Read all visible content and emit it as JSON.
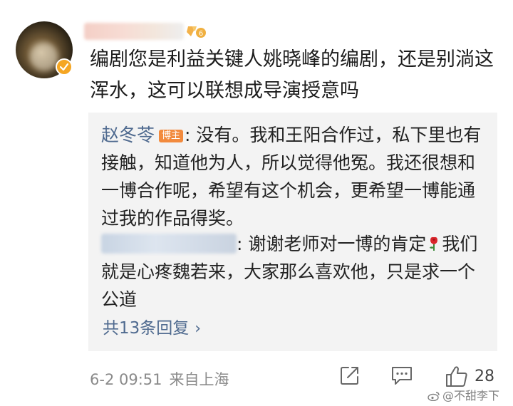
{
  "comment": {
    "text": "编剧您是利益关键人姚晓峰的编剧，还是别淌这浑水，这可以联想成导演授意吗"
  },
  "replies": [
    {
      "name": "赵冬苓",
      "tag": "博主",
      "text": ": 没有。我和王阳合作过，私下里也有接触，知道他为人，所以觉得他冤。我还很想和一博合作呢，希望有这个机会，更希望一博能通过我的作品得奖。"
    },
    {
      "text_before": ": 谢谢老师对一博的肯定",
      "text_after": "我们就是心疼魏若来，大家那么喜欢他，只是求一个公道"
    }
  ],
  "more_replies": {
    "label": "共13条回复",
    "chevron": "›"
  },
  "footer": {
    "date": "6-2 09:51",
    "location": "来自上海",
    "like_count": "28"
  },
  "watermark": {
    "text": "@不甜李下"
  },
  "icons": {
    "verified": "verified-badge-icon",
    "level": "level-badge-icon",
    "rose": "rose-emoji-icon",
    "share": "share-icon",
    "comment": "comment-icon",
    "like": "thumbs-up-icon",
    "weibo": "weibo-logo-icon"
  },
  "colors": {
    "link_blue": "#4f6a8f",
    "tag_orange": "#f28a3d",
    "reply_bg": "#f3f3f3",
    "meta_gray": "#8a8a8a",
    "verified_gold": "#f5a623"
  }
}
